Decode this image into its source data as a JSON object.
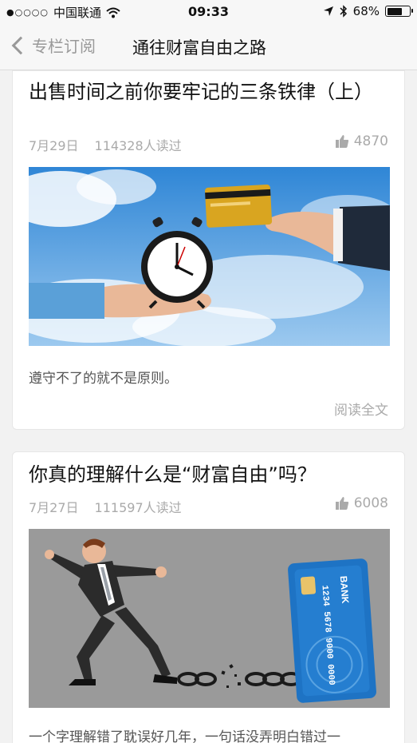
{
  "status_bar": {
    "carrier": "中国联通",
    "time": "09:33",
    "battery": "68%",
    "battery_level": 0.68
  },
  "nav": {
    "back_label": "专栏订阅",
    "title": "通往财富自由之路"
  },
  "articles": [
    {
      "title": "出售时间之前你要牢记的三条铁律（上）",
      "date": "7月29日",
      "reads": "114328人读过",
      "likes": "4870",
      "excerpt": "遵守不了的就不是原则。",
      "read_more": "阅读全文"
    },
    {
      "title": "你真的理解什么是“财富自由”吗？",
      "date": "7月27日",
      "reads": "111597人读过",
      "likes": "6008",
      "excerpt": "一个字理解错了耽误好几年，一句话没弄明白错过一",
      "card_text": {
        "bank": "BANK",
        "number": "1234 5678 9000 0000"
      }
    }
  ]
}
